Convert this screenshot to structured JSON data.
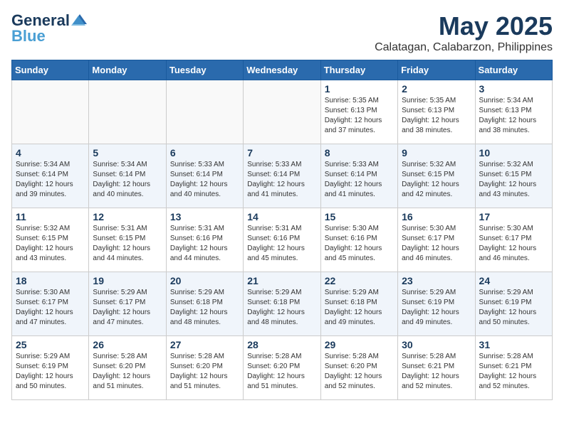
{
  "logo": {
    "line1": "General",
    "line2": "Blue"
  },
  "title": "May 2025",
  "location": "Calatagan, Calabarzon, Philippines",
  "weekdays": [
    "Sunday",
    "Monday",
    "Tuesday",
    "Wednesday",
    "Thursday",
    "Friday",
    "Saturday"
  ],
  "weeks": [
    {
      "alt": false,
      "days": [
        {
          "num": "",
          "info": ""
        },
        {
          "num": "",
          "info": ""
        },
        {
          "num": "",
          "info": ""
        },
        {
          "num": "",
          "info": ""
        },
        {
          "num": "1",
          "info": "Sunrise: 5:35 AM\nSunset: 6:13 PM\nDaylight: 12 hours\nand 37 minutes."
        },
        {
          "num": "2",
          "info": "Sunrise: 5:35 AM\nSunset: 6:13 PM\nDaylight: 12 hours\nand 38 minutes."
        },
        {
          "num": "3",
          "info": "Sunrise: 5:34 AM\nSunset: 6:13 PM\nDaylight: 12 hours\nand 38 minutes."
        }
      ]
    },
    {
      "alt": true,
      "days": [
        {
          "num": "4",
          "info": "Sunrise: 5:34 AM\nSunset: 6:14 PM\nDaylight: 12 hours\nand 39 minutes."
        },
        {
          "num": "5",
          "info": "Sunrise: 5:34 AM\nSunset: 6:14 PM\nDaylight: 12 hours\nand 40 minutes."
        },
        {
          "num": "6",
          "info": "Sunrise: 5:33 AM\nSunset: 6:14 PM\nDaylight: 12 hours\nand 40 minutes."
        },
        {
          "num": "7",
          "info": "Sunrise: 5:33 AM\nSunset: 6:14 PM\nDaylight: 12 hours\nand 41 minutes."
        },
        {
          "num": "8",
          "info": "Sunrise: 5:33 AM\nSunset: 6:14 PM\nDaylight: 12 hours\nand 41 minutes."
        },
        {
          "num": "9",
          "info": "Sunrise: 5:32 AM\nSunset: 6:15 PM\nDaylight: 12 hours\nand 42 minutes."
        },
        {
          "num": "10",
          "info": "Sunrise: 5:32 AM\nSunset: 6:15 PM\nDaylight: 12 hours\nand 43 minutes."
        }
      ]
    },
    {
      "alt": false,
      "days": [
        {
          "num": "11",
          "info": "Sunrise: 5:32 AM\nSunset: 6:15 PM\nDaylight: 12 hours\nand 43 minutes."
        },
        {
          "num": "12",
          "info": "Sunrise: 5:31 AM\nSunset: 6:15 PM\nDaylight: 12 hours\nand 44 minutes."
        },
        {
          "num": "13",
          "info": "Sunrise: 5:31 AM\nSunset: 6:16 PM\nDaylight: 12 hours\nand 44 minutes."
        },
        {
          "num": "14",
          "info": "Sunrise: 5:31 AM\nSunset: 6:16 PM\nDaylight: 12 hours\nand 45 minutes."
        },
        {
          "num": "15",
          "info": "Sunrise: 5:30 AM\nSunset: 6:16 PM\nDaylight: 12 hours\nand 45 minutes."
        },
        {
          "num": "16",
          "info": "Sunrise: 5:30 AM\nSunset: 6:17 PM\nDaylight: 12 hours\nand 46 minutes."
        },
        {
          "num": "17",
          "info": "Sunrise: 5:30 AM\nSunset: 6:17 PM\nDaylight: 12 hours\nand 46 minutes."
        }
      ]
    },
    {
      "alt": true,
      "days": [
        {
          "num": "18",
          "info": "Sunrise: 5:30 AM\nSunset: 6:17 PM\nDaylight: 12 hours\nand 47 minutes."
        },
        {
          "num": "19",
          "info": "Sunrise: 5:29 AM\nSunset: 6:17 PM\nDaylight: 12 hours\nand 47 minutes."
        },
        {
          "num": "20",
          "info": "Sunrise: 5:29 AM\nSunset: 6:18 PM\nDaylight: 12 hours\nand 48 minutes."
        },
        {
          "num": "21",
          "info": "Sunrise: 5:29 AM\nSunset: 6:18 PM\nDaylight: 12 hours\nand 48 minutes."
        },
        {
          "num": "22",
          "info": "Sunrise: 5:29 AM\nSunset: 6:18 PM\nDaylight: 12 hours\nand 49 minutes."
        },
        {
          "num": "23",
          "info": "Sunrise: 5:29 AM\nSunset: 6:19 PM\nDaylight: 12 hours\nand 49 minutes."
        },
        {
          "num": "24",
          "info": "Sunrise: 5:29 AM\nSunset: 6:19 PM\nDaylight: 12 hours\nand 50 minutes."
        }
      ]
    },
    {
      "alt": false,
      "days": [
        {
          "num": "25",
          "info": "Sunrise: 5:29 AM\nSunset: 6:19 PM\nDaylight: 12 hours\nand 50 minutes."
        },
        {
          "num": "26",
          "info": "Sunrise: 5:28 AM\nSunset: 6:20 PM\nDaylight: 12 hours\nand 51 minutes."
        },
        {
          "num": "27",
          "info": "Sunrise: 5:28 AM\nSunset: 6:20 PM\nDaylight: 12 hours\nand 51 minutes."
        },
        {
          "num": "28",
          "info": "Sunrise: 5:28 AM\nSunset: 6:20 PM\nDaylight: 12 hours\nand 51 minutes."
        },
        {
          "num": "29",
          "info": "Sunrise: 5:28 AM\nSunset: 6:20 PM\nDaylight: 12 hours\nand 52 minutes."
        },
        {
          "num": "30",
          "info": "Sunrise: 5:28 AM\nSunset: 6:21 PM\nDaylight: 12 hours\nand 52 minutes."
        },
        {
          "num": "31",
          "info": "Sunrise: 5:28 AM\nSunset: 6:21 PM\nDaylight: 12 hours\nand 52 minutes."
        }
      ]
    }
  ]
}
